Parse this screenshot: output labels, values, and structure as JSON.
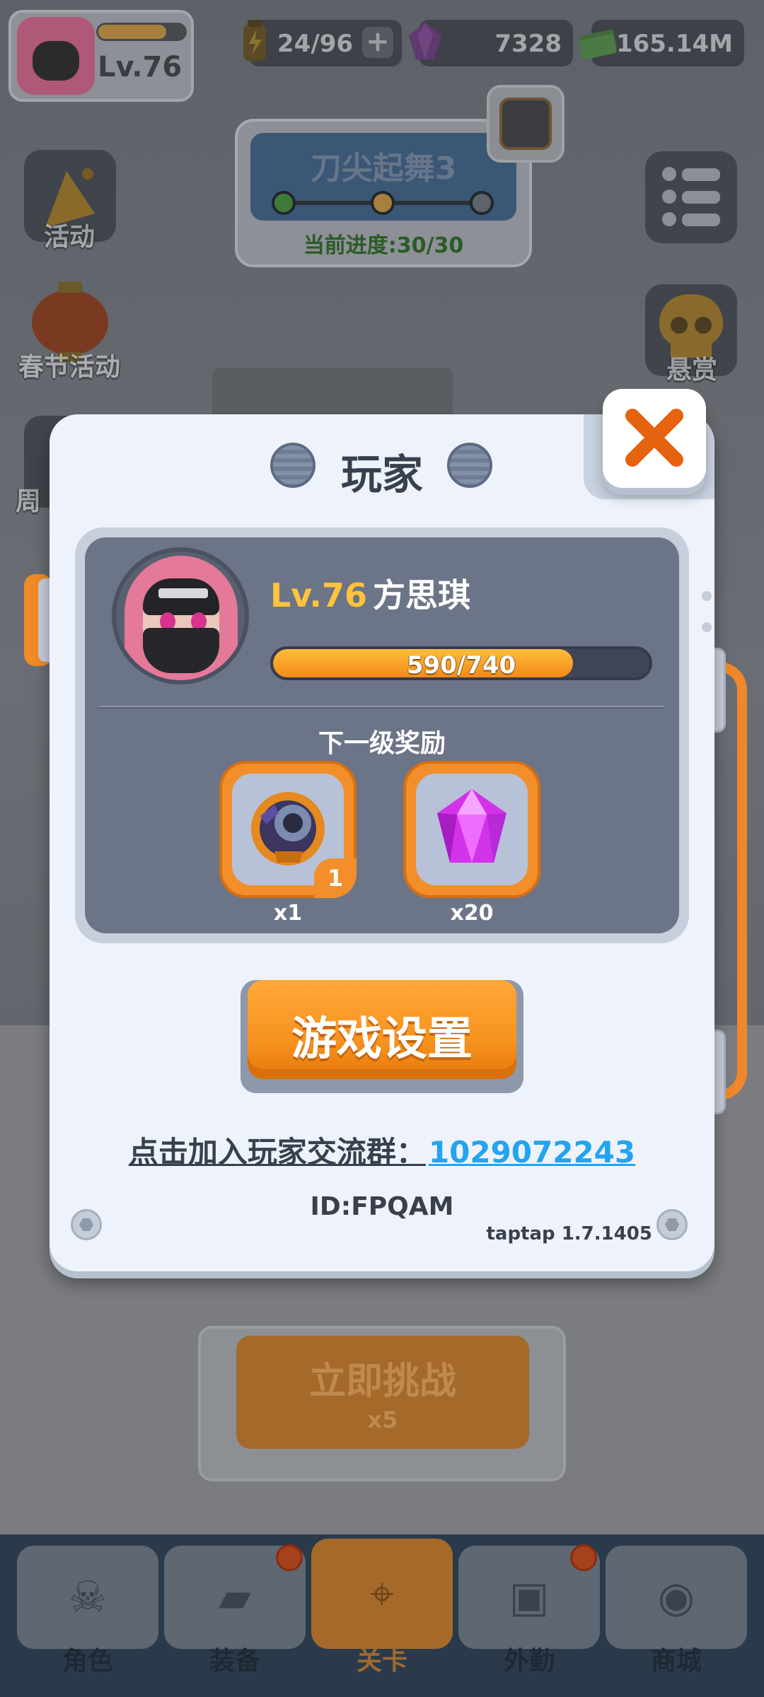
{
  "top_bar": {
    "player_level": "Lv.76",
    "energy": "24/96",
    "gems": "7328",
    "cash": "165.14M"
  },
  "stage": {
    "title": "刀尖起舞3",
    "progress": "当前进度:30/30"
  },
  "side_menu": {
    "events": "活动",
    "spring_festival": "春节活动",
    "weekly_partial": "周",
    "bounty": "悬赏"
  },
  "challenge": {
    "label": "立即挑战",
    "cost": "x5"
  },
  "bottom_nav": {
    "tabs": [
      {
        "label": "角色"
      },
      {
        "label": "装备"
      },
      {
        "label": "关卡"
      },
      {
        "label": "外勤"
      },
      {
        "label": "商城"
      }
    ],
    "active_index": 2
  },
  "dialog": {
    "title": "玩家",
    "level": "Lv.76",
    "player_name": "方思琪",
    "xp_text": "590/740",
    "xp_fraction": 0.797,
    "next_reward_title": "下一级奖励",
    "rewards": [
      {
        "icon": "armor-gear-icon",
        "qty": "x1",
        "badge": "1"
      },
      {
        "icon": "purple-gem-icon",
        "qty": "x20"
      }
    ],
    "settings_button": "游戏设置",
    "group_prompt": "点击加入玩家交流群：",
    "group_number": "1029072243",
    "player_id": "ID:FPQAM",
    "version": "taptap 1.7.1405"
  },
  "colors": {
    "accent_orange": "#f7931f",
    "level_yellow": "#ffc33c",
    "link_blue": "#22a4f2",
    "dialog_bg": "#eef3fb",
    "panel_bg": "#6c7488"
  }
}
